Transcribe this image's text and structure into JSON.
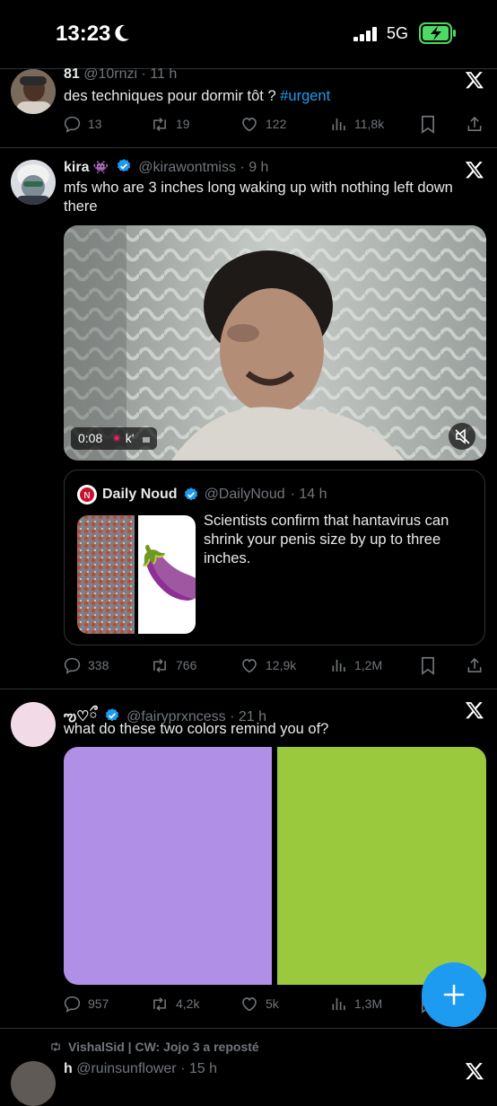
{
  "status_bar": {
    "time": "13:23",
    "network": "5G"
  },
  "tweets": [
    {
      "name": "81",
      "handle": "@10rnzi",
      "time": "· 11 h",
      "text": "des techniques pour dormir tôt ? ",
      "hashtag": "#urgent",
      "replies": "13",
      "reposts": "19",
      "likes": "122",
      "views": "11,8k"
    },
    {
      "name": "kira",
      "emoji": "👾",
      "handle": "@kirawontmiss",
      "time": "· 9 h",
      "text": "mfs who are 3 inches long waking up with nothing left down there",
      "video_time": "0:08",
      "video_caption": "k'",
      "quote": {
        "name": "Daily Noud",
        "handle": "@DailyNoud",
        "time": "· 14 h",
        "text": "Scientists confirm that hantavirus can shrink your penis size by up to three inches.",
        "emoji": "🍆"
      },
      "replies": "338",
      "reposts": "766",
      "likes": "12,9k",
      "views": "1,2M"
    },
    {
      "name": "ఌ♡ྀ",
      "handle": "@fairyprxncess",
      "time": "· 21 h",
      "text": "what do these two colors remind you of?",
      "colors": [
        "#b08fe6",
        "#9bc93e"
      ],
      "replies": "957",
      "reposts": "4,2k",
      "likes": "5k",
      "views": "1,3M"
    },
    {
      "repost_label": "VishalSid | CW: Jojo 3 a reposté",
      "name": "h",
      "handle": "@ruinsunflower",
      "time": "· 15 h"
    }
  ],
  "colors": {
    "accent": "#1d9bf0",
    "muted": "#71767b",
    "divider": "#2f3336"
  }
}
